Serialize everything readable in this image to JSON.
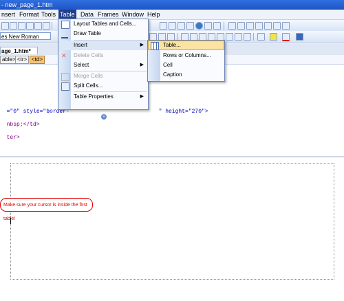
{
  "window": {
    "title": "- new_page_1.htm"
  },
  "menubar": {
    "items": [
      "nsert",
      "Format",
      "Tools",
      "Table",
      "Data",
      "Frames",
      "Window",
      "Help"
    ],
    "active": "Table"
  },
  "font": {
    "name": "es New Roman"
  },
  "document_tab": {
    "label": "age_1.htm*"
  },
  "tag_selector": {
    "tags": [
      "able>",
      "<tr>",
      "<td>"
    ]
  },
  "code": {
    "line1_prefix": "=\"0\" style=\"border-",
    "line1_suffix": "\" height=\"270\">",
    "line2": "nbsp;</td>",
    "line3": "ter>"
  },
  "design_view": {
    "note": "Make sure your cursor is inside the first table!"
  },
  "table_menu": {
    "items": [
      {
        "label": "Layout Tables and Cells...",
        "enabled": true,
        "icon": "layout-table-icon"
      },
      {
        "label": "Draw Table",
        "enabled": true,
        "icon": "pencil-icon"
      },
      {
        "label": "Insert",
        "enabled": true,
        "submenu": true,
        "highlighted": true
      },
      {
        "label": "Delete Cells",
        "enabled": false,
        "icon": "delete-cells-icon"
      },
      {
        "label": "Select",
        "enabled": true,
        "submenu": true
      },
      {
        "label": "Merge Cells",
        "enabled": false,
        "icon": "merge-cells-icon"
      },
      {
        "label": "Split Cells...",
        "enabled": true,
        "icon": "split-cells-icon"
      },
      {
        "label": "Table Properties",
        "enabled": true,
        "submenu": true
      }
    ],
    "expand_icon": "chevron-double-down-icon"
  },
  "insert_submenu": {
    "items": [
      {
        "label": "Table...",
        "highlighted": true,
        "icon": "table-icon"
      },
      {
        "label": "Rows or Columns...",
        "highlighted": false
      },
      {
        "label": "Cell",
        "highlighted": false
      },
      {
        "label": "Caption",
        "highlighted": false
      }
    ]
  },
  "colors": {
    "menu_active": "#1f3f8f",
    "menu_highlight": "#fbe3a4",
    "note_red": "#e00000",
    "code_purple": "#800080",
    "code_blue": "#0000c0"
  }
}
